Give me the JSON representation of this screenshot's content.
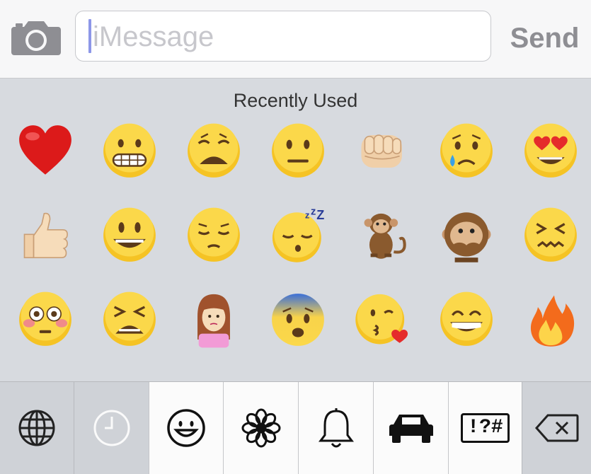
{
  "input_bar": {
    "camera_icon": "camera-icon",
    "message_placeholder": "iMessage",
    "send_label": "Send"
  },
  "emoji_panel": {
    "section_title": "Recently Used",
    "rows": [
      [
        "red-heart",
        "grimacing-face",
        "weary-face",
        "neutral-face",
        "oncoming-fist",
        "crying-face",
        "heart-eyes-face"
      ],
      [
        "thumbs-up",
        "smiley-face",
        "pensive-face",
        "sleeping-face",
        "monkey",
        "speak-no-evil-monkey",
        "confounded-face"
      ],
      [
        "flushed-face",
        "tired-face",
        "person-pouting",
        "fearful-face",
        "face-blowing-kiss",
        "grinning-face",
        "fire"
      ]
    ]
  },
  "toolbar": {
    "buttons": [
      "globe-icon",
      "recent-clock-icon",
      "smiley-icon",
      "flower-icon",
      "bell-icon",
      "car-icon",
      "symbols-icon",
      "delete-icon"
    ],
    "symbols_label": "!?#",
    "selected": "recent-clock-icon"
  }
}
